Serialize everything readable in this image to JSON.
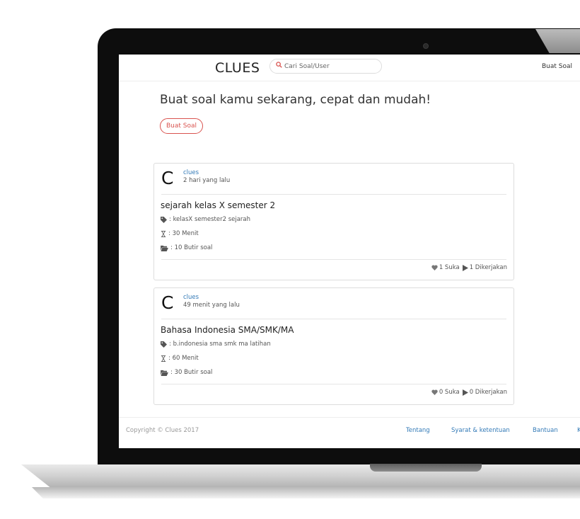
{
  "app": {
    "brand": "CLUES"
  },
  "search": {
    "placeholder": "Cari Soal/User"
  },
  "navbar": {
    "buat_soal_link": "Buat Soal"
  },
  "hero": {
    "headline": "Buat soal kamu sekarang, cepat dan mudah!",
    "button_label": "Buat Soal"
  },
  "cards": [
    {
      "avatar_letter": "C",
      "author": "clues",
      "time": "2 hari yang lalu",
      "title": "sejarah kelas X semester 2",
      "tags": ": kelasX semester2 sejarah",
      "duration": ": 30 Menit",
      "questions": ": 10 Butir soal",
      "likes": "1 Suka",
      "done": "1 Dikerjakan"
    },
    {
      "avatar_letter": "C",
      "author": "clues",
      "time": "49 menit yang lalu",
      "title": "Bahasa Indonesia SMA/SMK/MA",
      "tags": ": b.indonesia sma smk ma latihan",
      "duration": ": 60 Menit",
      "questions": ": 30 Butir soal",
      "likes": "0 Suka",
      "done": "0 Dikerjakan"
    }
  ],
  "footer": {
    "copyright": "Copyright © Clues 2017",
    "links": [
      "Tentang",
      "Syarat & ketentuan",
      "Bantuan"
    ],
    "cut_link": "K"
  },
  "colors": {
    "accent_red": "#d9534f",
    "link_blue": "#337ab7"
  },
  "icons": [
    "search-icon",
    "tag-icon",
    "hourglass-icon",
    "folder-open-icon",
    "heart-icon",
    "play-icon",
    "camera-icon"
  ]
}
